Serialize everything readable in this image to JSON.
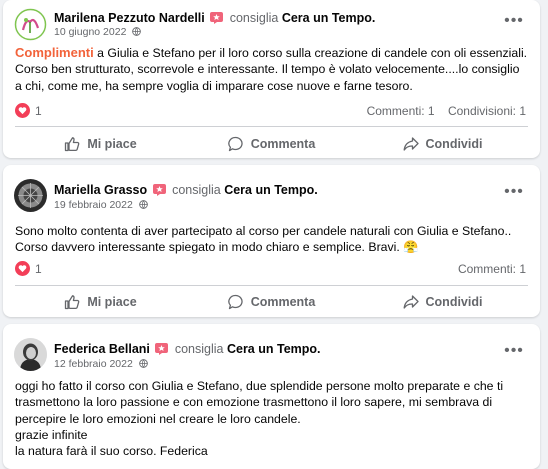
{
  "posts": [
    {
      "author": "Marilena Pezzuto Nardelli",
      "verb": "consiglia",
      "page": "Cera un Tempo.",
      "date": "10 giugno 2022",
      "highlight": "Complimenti",
      "text": " a Giulia e Stefano per il loro corso sulla creazione di candele con oli essenziali. Corso ben strutturato, scorrevole e interessante. Il tempo è volato velocemente....lo consiglio a chi, come me, ha sempre voglia di imparare cose nuove e farne tesoro.",
      "reactions": "1",
      "comments": "Commenti: 1",
      "shares": "Condivisioni: 1"
    },
    {
      "author": "Mariella Grasso",
      "verb": "consiglia",
      "page": "Cera un Tempo.",
      "date": "19 febbraio 2022",
      "text": "Sono molto contenta di aver   partecipato al corso per candele naturali con Giulia e Stefano.. Corso davvero interessante spiegato in modo chiaro e semplice. Bravi. 😤",
      "reactions": "1",
      "comments": "Commenti: 1"
    },
    {
      "author": "Federica Bellani",
      "verb": "consiglia",
      "page": "Cera un Tempo.",
      "date": "12 febbraio 2022",
      "text_lines": [
        "oggi ho fatto il corso con Giulia e Stefano, due splendide persone molto preparate e che ti trasmettono la loro passione e con emozione trasmettono il loro sapere,  mi sembrava di percepire le loro emozioni nel creare le loro candele.",
        "grazie infinite",
        "la natura farà il suo corso. Federica"
      ]
    }
  ],
  "actions": {
    "like": "Mi piace",
    "comment": "Commenta",
    "share": "Condividi"
  },
  "more_glyph": "•••",
  "colors": {
    "highlight": "#f2633b",
    "heart": "#f33e58",
    "recommend_badge": "#f0647a"
  },
  "icons": [
    "globe-icon",
    "recommend-icon",
    "heart-icon",
    "like-icon",
    "comment-icon",
    "share-icon",
    "more-options-icon"
  ]
}
